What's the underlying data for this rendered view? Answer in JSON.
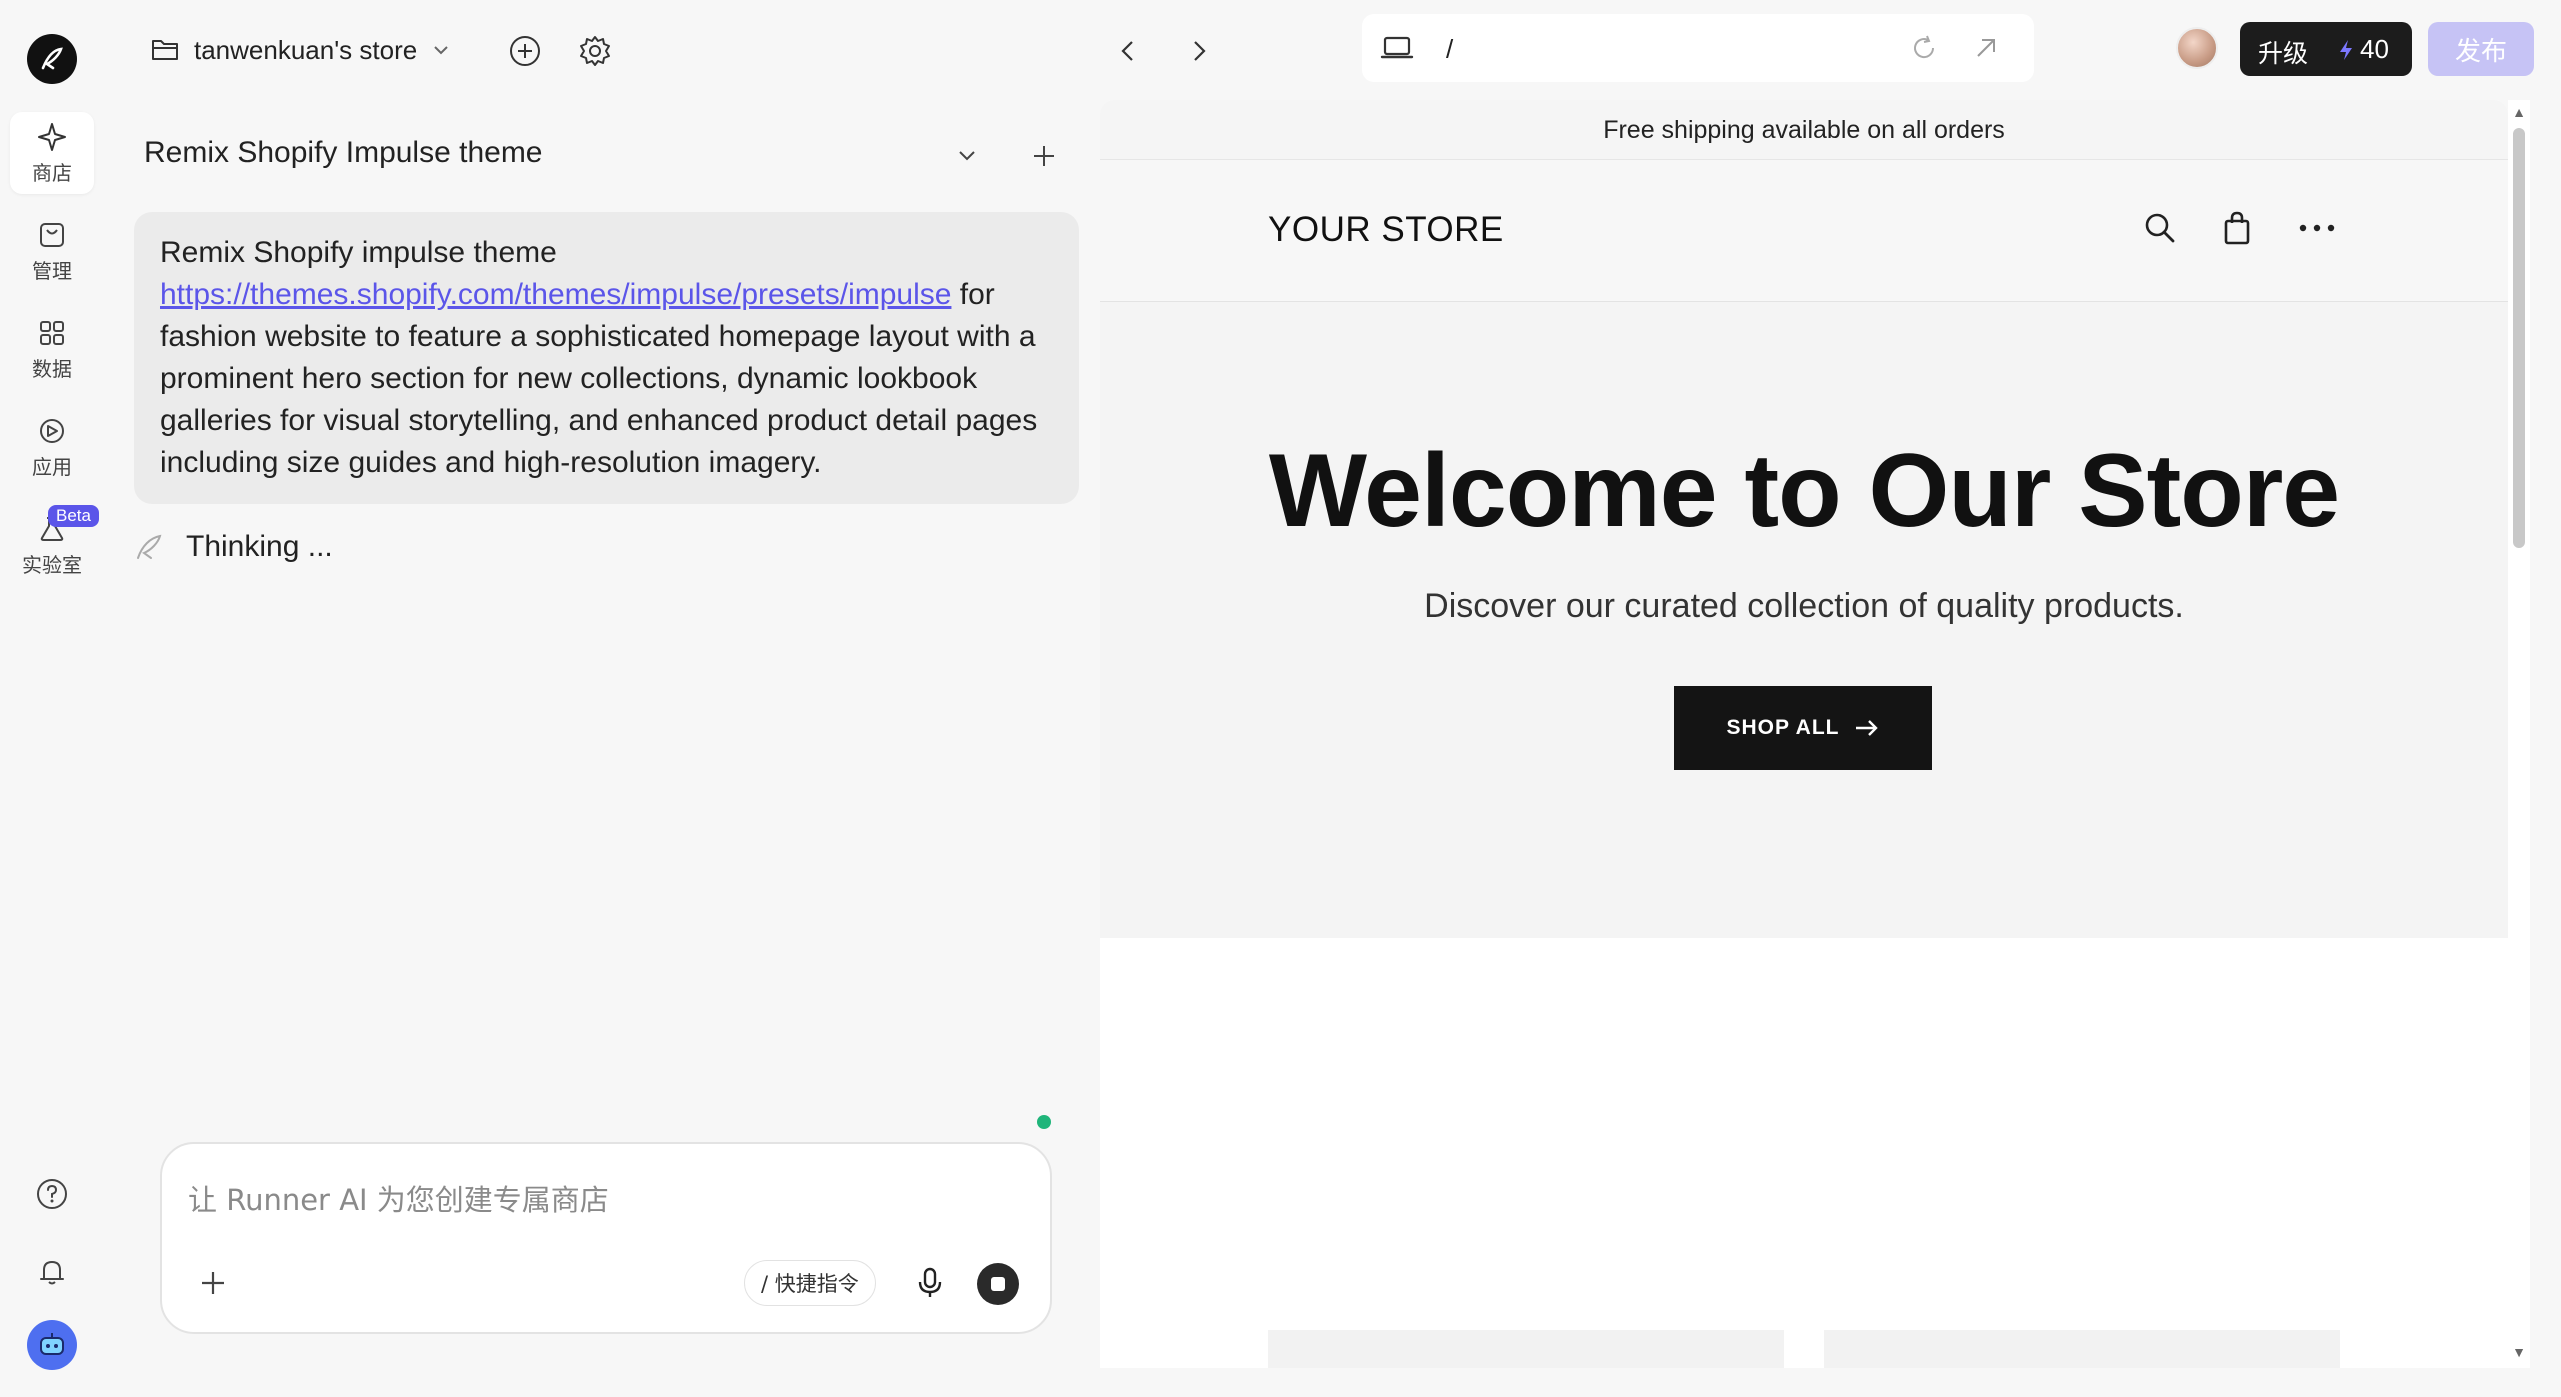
{
  "rail": {
    "items": [
      {
        "label": "商店"
      },
      {
        "label": "管理"
      },
      {
        "label": "数据"
      },
      {
        "label": "应用"
      },
      {
        "label": "实验室"
      }
    ],
    "beta_badge": "Beta"
  },
  "topbar": {
    "store_name": "tanwenkuan's store",
    "url_path": "/",
    "upgrade_label": "升级",
    "credits": "40",
    "publish_label": "发布"
  },
  "chat": {
    "title": "Remix Shopify Impulse theme",
    "message": {
      "line1": "Remix Shopify impulse theme",
      "link": "https://themes.shopify.com/themes/impulse/presets/impulse",
      "rest": " for fashion website to feature a sophisticated homepage layout with a prominent hero section for new collections, dynamic lookbook galleries for visual storytelling, and enhanced product detail pages including size guides and high-resolution imagery."
    },
    "thinking": "Thinking ...",
    "input_placeholder": "让 Runner AI 为您创建专属商店",
    "shortcut_label": "/ 快捷指令"
  },
  "preview": {
    "announcement": "Free shipping available on all orders",
    "store_logo": "YOUR STORE",
    "hero_title": "Welcome to Our Store",
    "hero_subtitle": "Discover our curated collection of quality products.",
    "cta_label": "SHOP ALL"
  },
  "colors": {
    "accent": "#5b55e9",
    "publish_disabled": "#c6c3f5",
    "status_online": "#1fb57a"
  }
}
